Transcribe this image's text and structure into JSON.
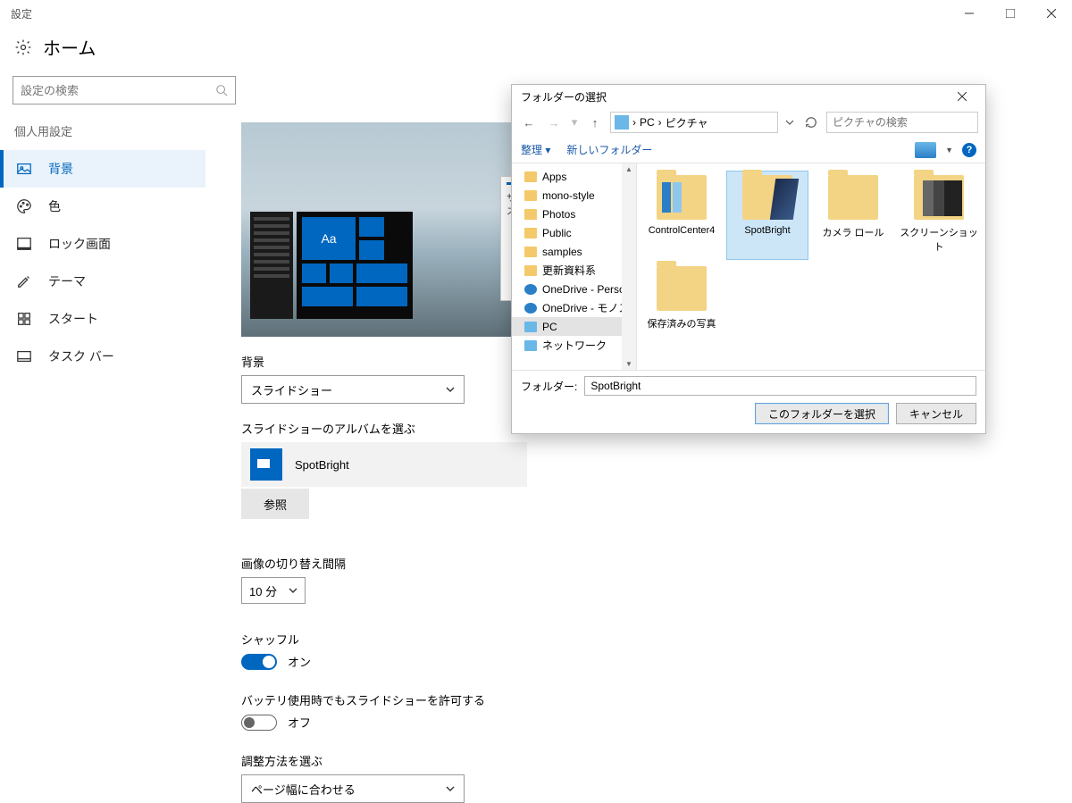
{
  "window": {
    "title": "設定"
  },
  "home": {
    "label": "ホーム"
  },
  "search": {
    "placeholder": "設定の検索"
  },
  "category": {
    "title": "個人用設定"
  },
  "nav": {
    "items": [
      {
        "label": "背景"
      },
      {
        "label": "色"
      },
      {
        "label": "ロック画面"
      },
      {
        "label": "テーマ"
      },
      {
        "label": "スタート"
      },
      {
        "label": "タスク バー"
      }
    ]
  },
  "preview": {
    "sample_text": "サンプル テキス",
    "tile_label": "Aa"
  },
  "background": {
    "label": "背景",
    "mode": "スライドショー",
    "album_label": "スライドショーのアルバムを選ぶ",
    "album_value": "SpotBright",
    "browse": "参照",
    "interval_label": "画像の切り替え間隔",
    "interval_value": "10 分",
    "shuffle_label": "シャッフル",
    "shuffle_state": "オン",
    "battery_label": "バッテリ使用時でもスライドショーを許可する",
    "battery_state": "オフ",
    "fit_label": "調整方法を選ぶ",
    "fit_value": "ページ幅に合わせる"
  },
  "dialog": {
    "title": "フォルダーの選択",
    "breadcrumb": {
      "root": "PC",
      "sep": "›",
      "current": "ピクチャ"
    },
    "search_placeholder": "ピクチャの検索",
    "toolbar": {
      "organize": "整理",
      "newfolder": "新しいフォルダー"
    },
    "tree": [
      {
        "label": "Apps",
        "icon": "folder"
      },
      {
        "label": "mono-style",
        "icon": "folder"
      },
      {
        "label": "Photos",
        "icon": "folder"
      },
      {
        "label": "Public",
        "icon": "folder"
      },
      {
        "label": "samples",
        "icon": "folder"
      },
      {
        "label": "更新資料系",
        "icon": "folder"
      },
      {
        "label": "OneDrive - Person",
        "icon": "cloud"
      },
      {
        "label": "OneDrive - モノスタ",
        "icon": "cloud"
      },
      {
        "label": "PC",
        "icon": "drive",
        "selected": true
      },
      {
        "label": "ネットワーク",
        "icon": "drive"
      }
    ],
    "folders": [
      {
        "label": "ControlCenter4",
        "variant": "cc"
      },
      {
        "label": "SpotBright",
        "variant": "spot",
        "selected": true
      },
      {
        "label": "カメラ ロール",
        "variant": ""
      },
      {
        "label": "スクリーンショット",
        "variant": "shot"
      },
      {
        "label": "保存済みの写真",
        "variant": ""
      }
    ],
    "folder_field_label": "フォルダー:",
    "folder_field_value": "SpotBright",
    "select": "このフォルダーを選択",
    "cancel": "キャンセル",
    "help": "?"
  }
}
